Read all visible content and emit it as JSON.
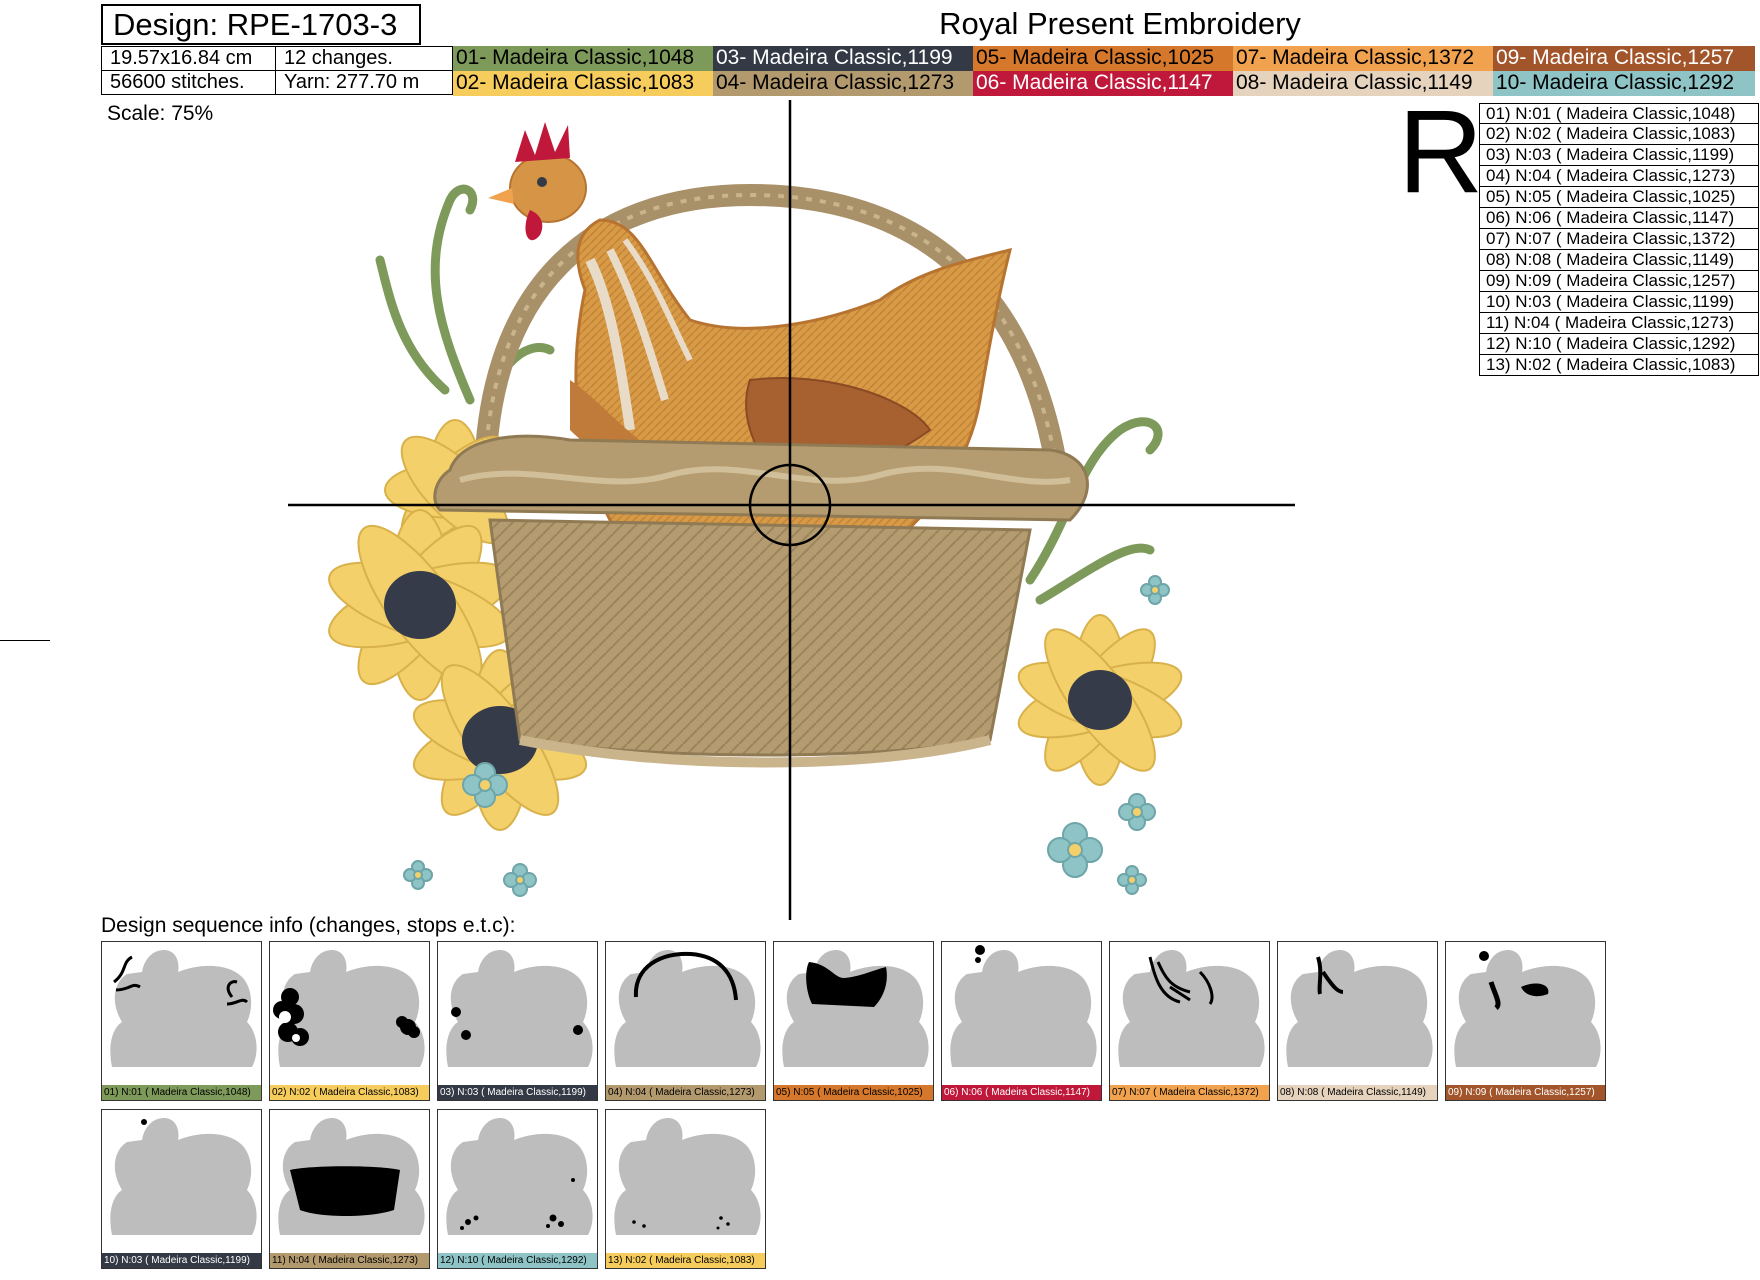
{
  "header": {
    "design_label": "Design: RPE-1703-3",
    "company": "Royal Present Embroidery",
    "size": "19.57x16.84 cm",
    "changes": "12 changes.",
    "stitches": "56600 stitches.",
    "yarn": "Yarn: 277.70 m",
    "scale": "Scale: 75%"
  },
  "colors": [
    {
      "label": "01- Madeira Classic,1048",
      "bg": "#7e9a5a",
      "fg": "#000000"
    },
    {
      "label": "02- Madeira Classic,1083",
      "bg": "#f6cd5c",
      "fg": "#000000"
    },
    {
      "label": "03- Madeira Classic,1199",
      "bg": "#333a45",
      "fg": "#ffffff"
    },
    {
      "label": "04- Madeira Classic,1273",
      "bg": "#b39a6e",
      "fg": "#000000"
    },
    {
      "label": "05- Madeira Classic,1025",
      "bg": "#d5782b",
      "fg": "#000000"
    },
    {
      "label": "06- Madeira Classic,1147",
      "bg": "#c0183a",
      "fg": "#ffffff"
    },
    {
      "label": "07- Madeira Classic,1372",
      "bg": "#f0a24f",
      "fg": "#000000"
    },
    {
      "label": "08- Madeira Classic,1149",
      "bg": "#e5d3bd",
      "fg": "#000000"
    },
    {
      "label": "09- Madeira Classic,1257",
      "bg": "#a2552a",
      "fg": "#ffffff"
    },
    {
      "label": "10- Madeira Classic,1292",
      "bg": "#8ec4c6",
      "fg": "#000000"
    }
  ],
  "logo_letter": "R",
  "sequence": [
    "01) N:01 ( Madeira Classic,1048)",
    "02) N:02 ( Madeira Classic,1083)",
    "03) N:03 ( Madeira Classic,1199)",
    "04) N:04 ( Madeira Classic,1273)",
    "05) N:05 ( Madeira Classic,1025)",
    "06) N:06 ( Madeira Classic,1147)",
    "07) N:07 ( Madeira Classic,1372)",
    "08) N:08 ( Madeira Classic,1149)",
    "09) N:09 ( Madeira Classic,1257)",
    "10) N:03 ( Madeira Classic,1199)",
    "11) N:04 ( Madeira Classic,1273)",
    "12) N:10 ( Madeira Classic,1292)",
    "13) N:02 ( Madeira Classic,1083)"
  ],
  "sequence_heading": "Design sequence info (changes, stops e.t.c):",
  "thumbnails": [
    {
      "label": "01) N:01 ( Madeira Classic,1048)",
      "bg": "#7e9a5a",
      "fg": "#000000",
      "part": "stems"
    },
    {
      "label": "02) N:02 ( Madeira Classic,1083)",
      "bg": "#f6cd5c",
      "fg": "#000000",
      "part": "petals"
    },
    {
      "label": "03) N:03 ( Madeira Classic,1199)",
      "bg": "#333a45",
      "fg": "#ffffff",
      "part": "centers"
    },
    {
      "label": "04) N:04 ( Madeira Classic,1273)",
      "bg": "#b39a6e",
      "fg": "#000000",
      "part": "handle"
    },
    {
      "label": "05) N:05 ( Madeira Classic,1025)",
      "bg": "#d5782b",
      "fg": "#000000",
      "part": "hen"
    },
    {
      "label": "06) N:06 ( Madeira Classic,1147)",
      "bg": "#c0183a",
      "fg": "#ffffff",
      "part": "comb"
    },
    {
      "label": "07) N:07 ( Madeira Classic,1372)",
      "bg": "#f0a24f",
      "fg": "#000000",
      "part": "feathers"
    },
    {
      "label": "08) N:08 ( Madeira Classic,1149)",
      "bg": "#e5d3bd",
      "fg": "#000000",
      "part": "neck"
    },
    {
      "label": "09) N:09 ( Madeira Classic,1257)",
      "bg": "#a2552a",
      "fg": "#ffffff",
      "part": "wing"
    },
    {
      "label": "10) N:03 ( Madeira Classic,1199)",
      "bg": "#333a45",
      "fg": "#ffffff",
      "part": "eye"
    },
    {
      "label": "11) N:04 ( Madeira Classic,1273)",
      "bg": "#b39a6e",
      "fg": "#000000",
      "part": "basket"
    },
    {
      "label": "12) N:10 ( Madeira Classic,1292)",
      "bg": "#8ec4c6",
      "fg": "#000000",
      "part": "blue-flowers"
    },
    {
      "label": "13) N:02 ( Madeira Classic,1083)",
      "bg": "#f6cd5c",
      "fg": "#000000",
      "part": "flower-dots"
    }
  ]
}
